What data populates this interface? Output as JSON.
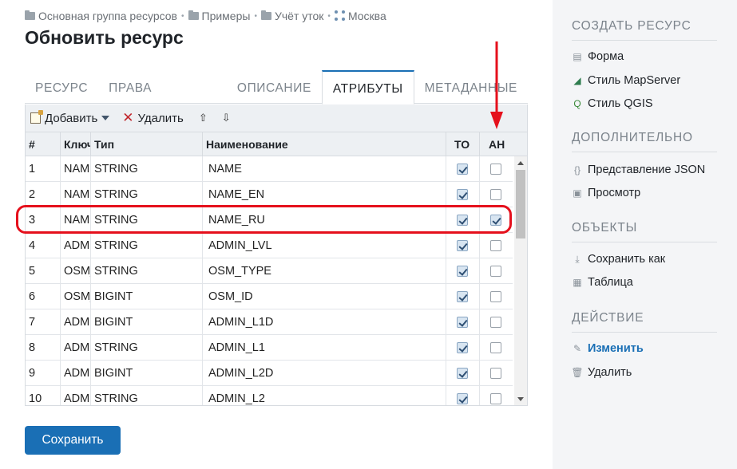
{
  "breadcrumb": [
    "Основная группа ресурсов",
    "Примеры",
    "Учёт уток",
    "Москва"
  ],
  "title": "Обновить ресурс",
  "tabs": [
    {
      "label": "РЕСУРС",
      "active": false
    },
    {
      "label": "ПРАВА ДОСТУПА",
      "active": false
    },
    {
      "label": "ОПИСАНИЕ",
      "active": false
    },
    {
      "label": "АТРИБУТЫ",
      "active": true
    },
    {
      "label": "МЕТАДАННЫЕ",
      "active": false
    }
  ],
  "toolbar": {
    "add_label": "Добавить",
    "delete_label": "Удалить",
    "up_icon": "⇧",
    "down_icon": "⇩"
  },
  "grid": {
    "headers": {
      "num": "#",
      "key": "Ключ",
      "type": "Тип",
      "name": "Наименование",
      "to": "ТО",
      "ah": "АН"
    },
    "rows": [
      {
        "num": "1",
        "key": "NAME",
        "type": "STRING",
        "name": "NAME",
        "to": true,
        "ah": false
      },
      {
        "num": "2",
        "key": "NAME",
        "type": "STRING",
        "name": "NAME_EN",
        "to": true,
        "ah": false
      },
      {
        "num": "3",
        "key": "NAME",
        "type": "STRING",
        "name": "NAME_RU",
        "to": true,
        "ah": true
      },
      {
        "num": "4",
        "key": "ADMIN",
        "type": "STRING",
        "name": "ADMIN_LVL",
        "to": true,
        "ah": false
      },
      {
        "num": "5",
        "key": "OSM_T",
        "type": "STRING",
        "name": "OSM_TYPE",
        "to": true,
        "ah": false
      },
      {
        "num": "6",
        "key": "OSM_I",
        "type": "BIGINT",
        "name": "OSM_ID",
        "to": true,
        "ah": false
      },
      {
        "num": "7",
        "key": "ADMIN",
        "type": "BIGINT",
        "name": "ADMIN_L1D",
        "to": true,
        "ah": false
      },
      {
        "num": "8",
        "key": "ADMIN",
        "type": "STRING",
        "name": "ADMIN_L1",
        "to": true,
        "ah": false
      },
      {
        "num": "9",
        "key": "ADMIN",
        "type": "BIGINT",
        "name": "ADMIN_L2D",
        "to": true,
        "ah": false
      },
      {
        "num": "10",
        "key": "ADMIN",
        "type": "STRING",
        "name": "ADMIN_L2",
        "to": true,
        "ah": false
      }
    ]
  },
  "save_label": "Сохранить",
  "sidebar": {
    "create_title": "СОЗДАТЬ РЕСУРС",
    "create_items": [
      "Форма",
      "Стиль MapServer",
      "Стиль QGIS"
    ],
    "extra_title": "ДОПОЛНИТЕЛЬНО",
    "extra_items": [
      "Представление JSON",
      "Просмотр"
    ],
    "objects_title": "ОБЪЕКТЫ",
    "objects_items": [
      "Сохранить как",
      "Таблица"
    ],
    "action_title": "ДЕЙСТВИЕ",
    "action_items": [
      "Изменить",
      "Удалить"
    ]
  },
  "colors": {
    "accent": "#1a6fb5",
    "highlight": "#e5101c"
  }
}
